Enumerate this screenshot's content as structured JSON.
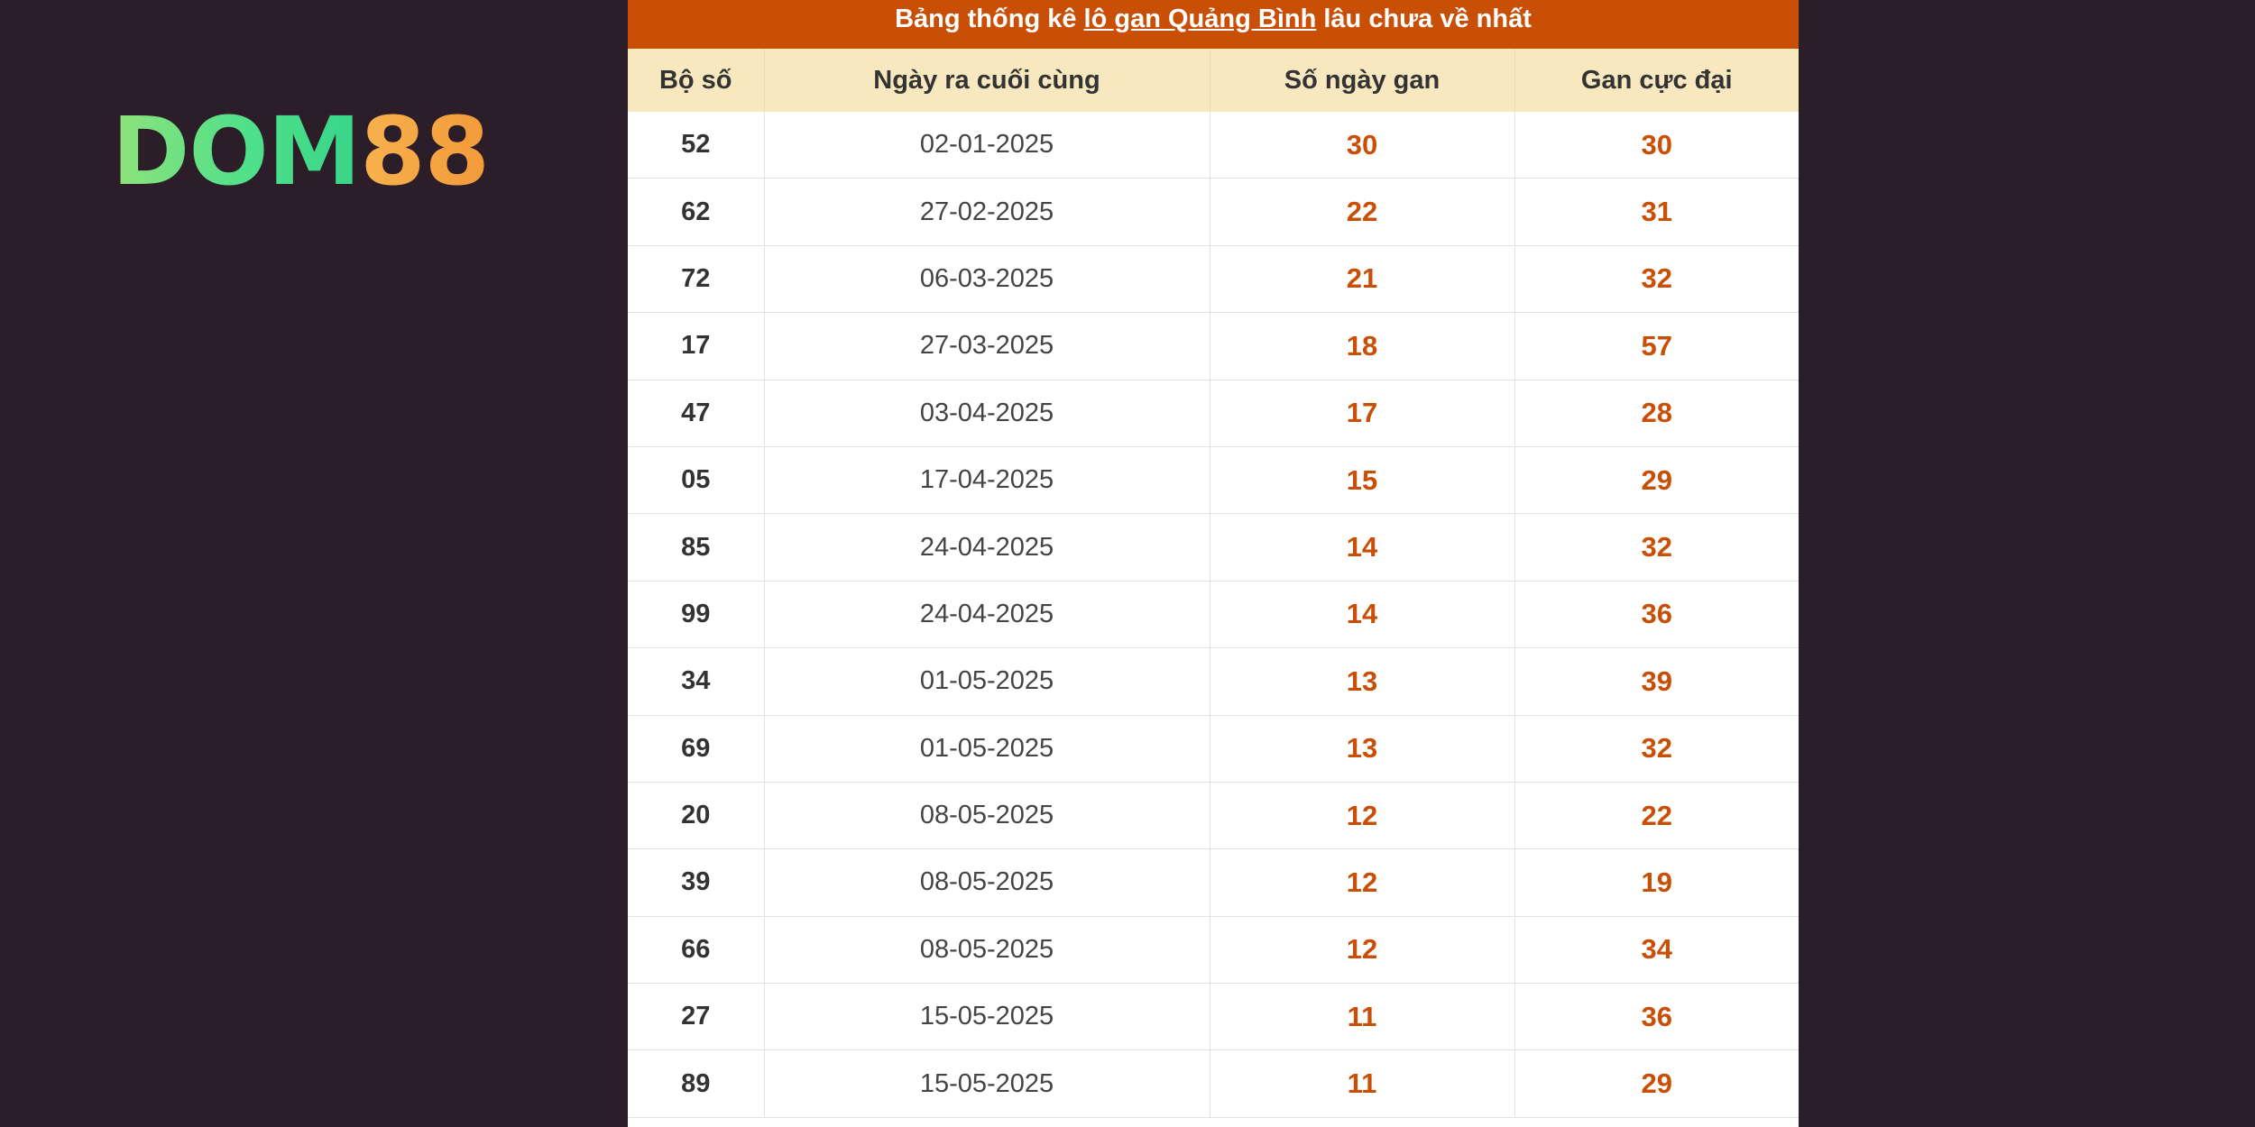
{
  "logo": {
    "part_a": "DOM",
    "part_b": "88"
  },
  "caption": {
    "prefix": "Bảng thống kê ",
    "link": "lô gan Quảng Bình",
    "suffix": " lâu chưa về nhất"
  },
  "table": {
    "headers": [
      "Bộ số",
      "Ngày ra cuối cùng",
      "Số ngày gan",
      "Gan cực đại"
    ],
    "rows": [
      [
        "52",
        "02-01-2025",
        "30",
        "30"
      ],
      [
        "62",
        "27-02-2025",
        "22",
        "31"
      ],
      [
        "72",
        "06-03-2025",
        "21",
        "32"
      ],
      [
        "17",
        "27-03-2025",
        "18",
        "57"
      ],
      [
        "47",
        "03-04-2025",
        "17",
        "28"
      ],
      [
        "05",
        "17-04-2025",
        "15",
        "29"
      ],
      [
        "85",
        "24-04-2025",
        "14",
        "32"
      ],
      [
        "99",
        "24-04-2025",
        "14",
        "36"
      ],
      [
        "34",
        "01-05-2025",
        "13",
        "39"
      ],
      [
        "69",
        "01-05-2025",
        "13",
        "32"
      ],
      [
        "20",
        "08-05-2025",
        "12",
        "22"
      ],
      [
        "39",
        "08-05-2025",
        "12",
        "19"
      ],
      [
        "66",
        "08-05-2025",
        "12",
        "34"
      ],
      [
        "27",
        "15-05-2025",
        "11",
        "36"
      ],
      [
        "89",
        "15-05-2025",
        "11",
        "29"
      ]
    ]
  },
  "colors": {
    "background": "#2b1e28",
    "caption_bg": "#c94f06",
    "header_bg": "#f8e8c0",
    "value_accent": "#c94f06",
    "logo_green": "#4fe08a",
    "logo_orange": "#f29a3a"
  }
}
